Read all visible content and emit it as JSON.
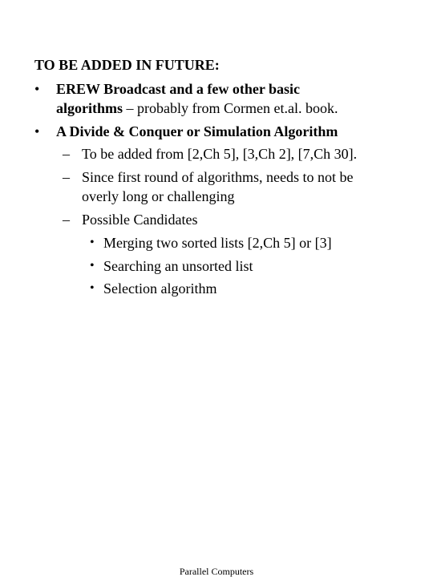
{
  "slide": {
    "heading": "TO BE ADDED IN FUTURE:",
    "items": [
      {
        "bullet": "•",
        "line1_bold": "EREW Broadcast and a few other basic",
        "line2_bold": "algorithms",
        "line2_rest": " – probably from Cormen et.al. book."
      },
      {
        "bullet": "•",
        "line1_bold": "A Divide & Conquer or Simulation Algorithm",
        "subitems": [
          {
            "dash": "–",
            "lines": [
              "To be added from [2,Ch 5], [3,Ch 2], [7,Ch 30]."
            ]
          },
          {
            "dash": "–",
            "lines": [
              "Since first round of algorithms, needs to not be",
              "overly long or challenging"
            ]
          },
          {
            "dash": "–",
            "lines": [
              "Possible Candidates"
            ],
            "subitems": [
              {
                "bullet": "•",
                "text": "Merging two sorted lists [2,Ch 5] or [3]"
              },
              {
                "bullet": "•",
                "text": "Searching an unsorted list"
              },
              {
                "bullet": "•",
                "text": "Selection algorithm"
              }
            ]
          }
        ]
      }
    ],
    "footer": "Parallel Computers"
  }
}
